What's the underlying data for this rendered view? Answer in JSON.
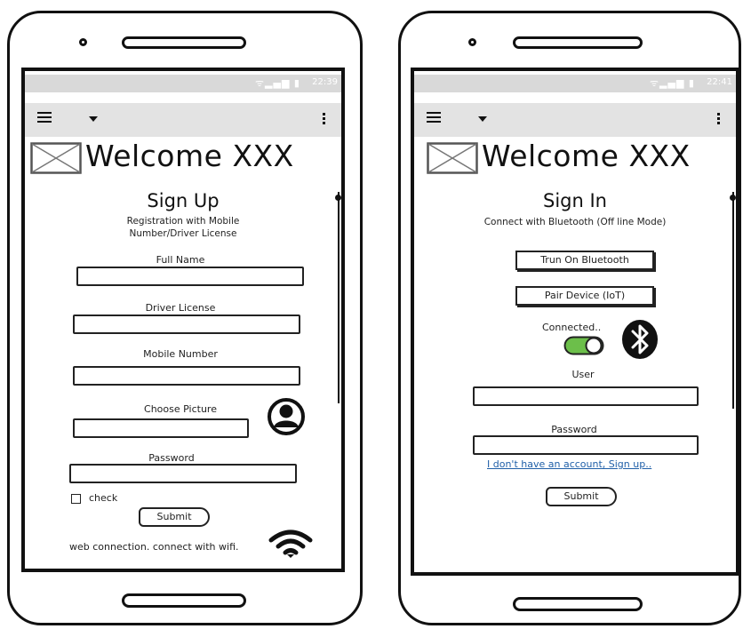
{
  "left_phone": {
    "status_time": "22:39",
    "welcome": "Welcome XXX",
    "title": "Sign Up",
    "subtitle_line1": "Registration with Mobile",
    "subtitle_line2": "Number/Driver License",
    "full_name_label": "Full Name",
    "driver_license_label": "Driver License",
    "mobile_label": "Mobile Number",
    "picture_label": "Choose Picture",
    "password_label": "Password",
    "check_label": "check",
    "submit_label": "Submit",
    "footer_text": "web connection. connect with wifi."
  },
  "right_phone": {
    "status_time": "22:41",
    "welcome": "Welcome XXX",
    "title": "Sign In",
    "subtitle": "Connect with Bluetooth (Off line Mode)",
    "bt_button": "Trun On Bluetooth",
    "pair_button": "Pair Device (IoT)",
    "connected_label": "Connected..",
    "toggle_on": true,
    "user_label": "User",
    "password_label": "Password",
    "signup_link": "I don't have an account, Sign up..",
    "submit_label": "Submit"
  },
  "icons": {
    "wifi": "wifi-icon",
    "bluetooth": "bluetooth-icon",
    "avatar": "user-avatar-icon",
    "image_placeholder": "image-placeholder-icon"
  },
  "colors": {
    "toggle_on": "#6cbf4a",
    "link": "#1f5fa8",
    "appbar": "#e3e3e3",
    "statusbar": "#d9d9d9"
  }
}
